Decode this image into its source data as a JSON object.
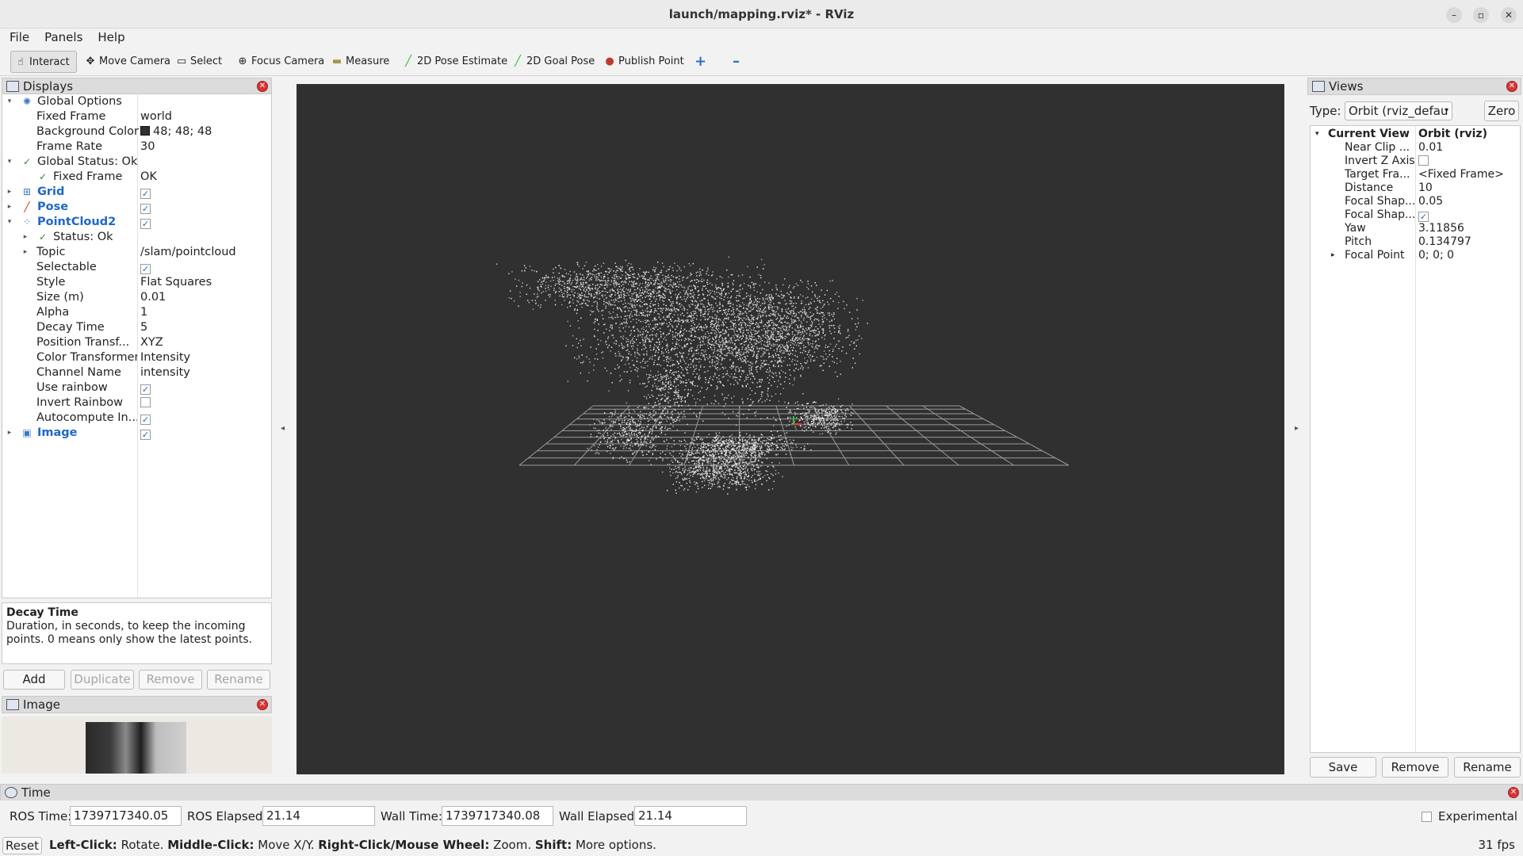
{
  "window": {
    "title": "launch/mapping.rviz* - RViz"
  },
  "menu": [
    "File",
    "Panels",
    "Help"
  ],
  "toolbar": [
    {
      "label": "Interact",
      "icon": "hand-icon"
    },
    {
      "label": "Move Camera",
      "icon": "move-camera-icon"
    },
    {
      "label": "Select",
      "icon": "select-icon"
    },
    {
      "label": "Focus Camera",
      "icon": "focus-camera-icon"
    },
    {
      "label": "Measure",
      "icon": "measure-icon"
    },
    {
      "label": "2D Pose Estimate",
      "icon": "pose-estimate-icon"
    },
    {
      "label": "2D Goal Pose",
      "icon": "goal-pose-icon"
    },
    {
      "label": "Publish Point",
      "icon": "publish-point-icon"
    }
  ],
  "displays": {
    "title": "Displays",
    "rows": [
      {
        "name": "Global Options",
        "value": ""
      },
      {
        "name": "Fixed Frame",
        "value": "world"
      },
      {
        "name": "Background Color",
        "value": "48; 48; 48"
      },
      {
        "name": "Frame Rate",
        "value": "30"
      },
      {
        "name": "Global Status: Ok",
        "value": ""
      },
      {
        "name": "Fixed Frame",
        "value": "OK"
      },
      {
        "name": "Grid",
        "value": ""
      },
      {
        "name": "Pose",
        "value": ""
      },
      {
        "name": "PointCloud2",
        "value": ""
      },
      {
        "name": "Status: Ok",
        "value": ""
      },
      {
        "name": "Topic",
        "value": "/slam/pointcloud"
      },
      {
        "name": "Selectable",
        "value": ""
      },
      {
        "name": "Style",
        "value": "Flat Squares"
      },
      {
        "name": "Size (m)",
        "value": "0.01"
      },
      {
        "name": "Alpha",
        "value": "1"
      },
      {
        "name": "Decay Time",
        "value": "5"
      },
      {
        "name": "Position Transf...",
        "value": "XYZ"
      },
      {
        "name": "Color Transformer",
        "value": "Intensity"
      },
      {
        "name": "Channel Name",
        "value": "intensity"
      },
      {
        "name": "Use rainbow",
        "value": ""
      },
      {
        "name": "Invert Rainbow",
        "value": ""
      },
      {
        "name": "Autocompute In...",
        "value": ""
      },
      {
        "name": "Image",
        "value": ""
      }
    ],
    "description_title": "Decay Time",
    "description_text": "Duration, in seconds, to keep the incoming points. 0 means only show the latest points.",
    "buttons": [
      "Add",
      "Duplicate",
      "Remove",
      "Rename"
    ]
  },
  "image_panel": {
    "title": "Image"
  },
  "views": {
    "title": "Views",
    "type_label": "Type:",
    "type_value": "Orbit (rviz_defau",
    "zero_label": "Zero",
    "rows": [
      {
        "name": "Current View",
        "value": "Orbit (rviz)"
      },
      {
        "name": "Near Clip ...",
        "value": "0.01"
      },
      {
        "name": "Invert Z Axis",
        "value": ""
      },
      {
        "name": "Target Fra...",
        "value": "<Fixed Frame>"
      },
      {
        "name": "Distance",
        "value": "10"
      },
      {
        "name": "Focal Shap...",
        "value": "0.05"
      },
      {
        "name": "Focal Shap...",
        "value": ""
      },
      {
        "name": "Yaw",
        "value": "3.11856"
      },
      {
        "name": "Pitch",
        "value": "0.134797"
      },
      {
        "name": "Focal Point",
        "value": "0; 0; 0"
      }
    ],
    "buttons": [
      "Save",
      "Remove",
      "Rename"
    ]
  },
  "time": {
    "title": "Time",
    "ros_time_label": "ROS Time:",
    "ros_time": "1739717340.05",
    "ros_elapsed_label": "ROS Elapsed:",
    "ros_elapsed": "21.14",
    "wall_time_label": "Wall Time:",
    "wall_time": "1739717340.08",
    "wall_elapsed_label": "Wall Elapsed:",
    "wall_elapsed": "21.14",
    "experimental_label": "Experimental"
  },
  "status": {
    "reset_label": "Reset",
    "lc": "Left-Click:",
    "lc_t": " Rotate. ",
    "mc": "Middle-Click:",
    "mc_t": " Move X/Y. ",
    "rc": "Right-Click/Mouse Wheel:",
    "rc_t": " Zoom. ",
    "sh": "Shift:",
    "sh_t": " More options.",
    "fps": "31 fps"
  },
  "colors": {
    "viewport_bg": "#303030",
    "accent": "#1f68c4",
    "status_ok": "#2a8a2a"
  }
}
